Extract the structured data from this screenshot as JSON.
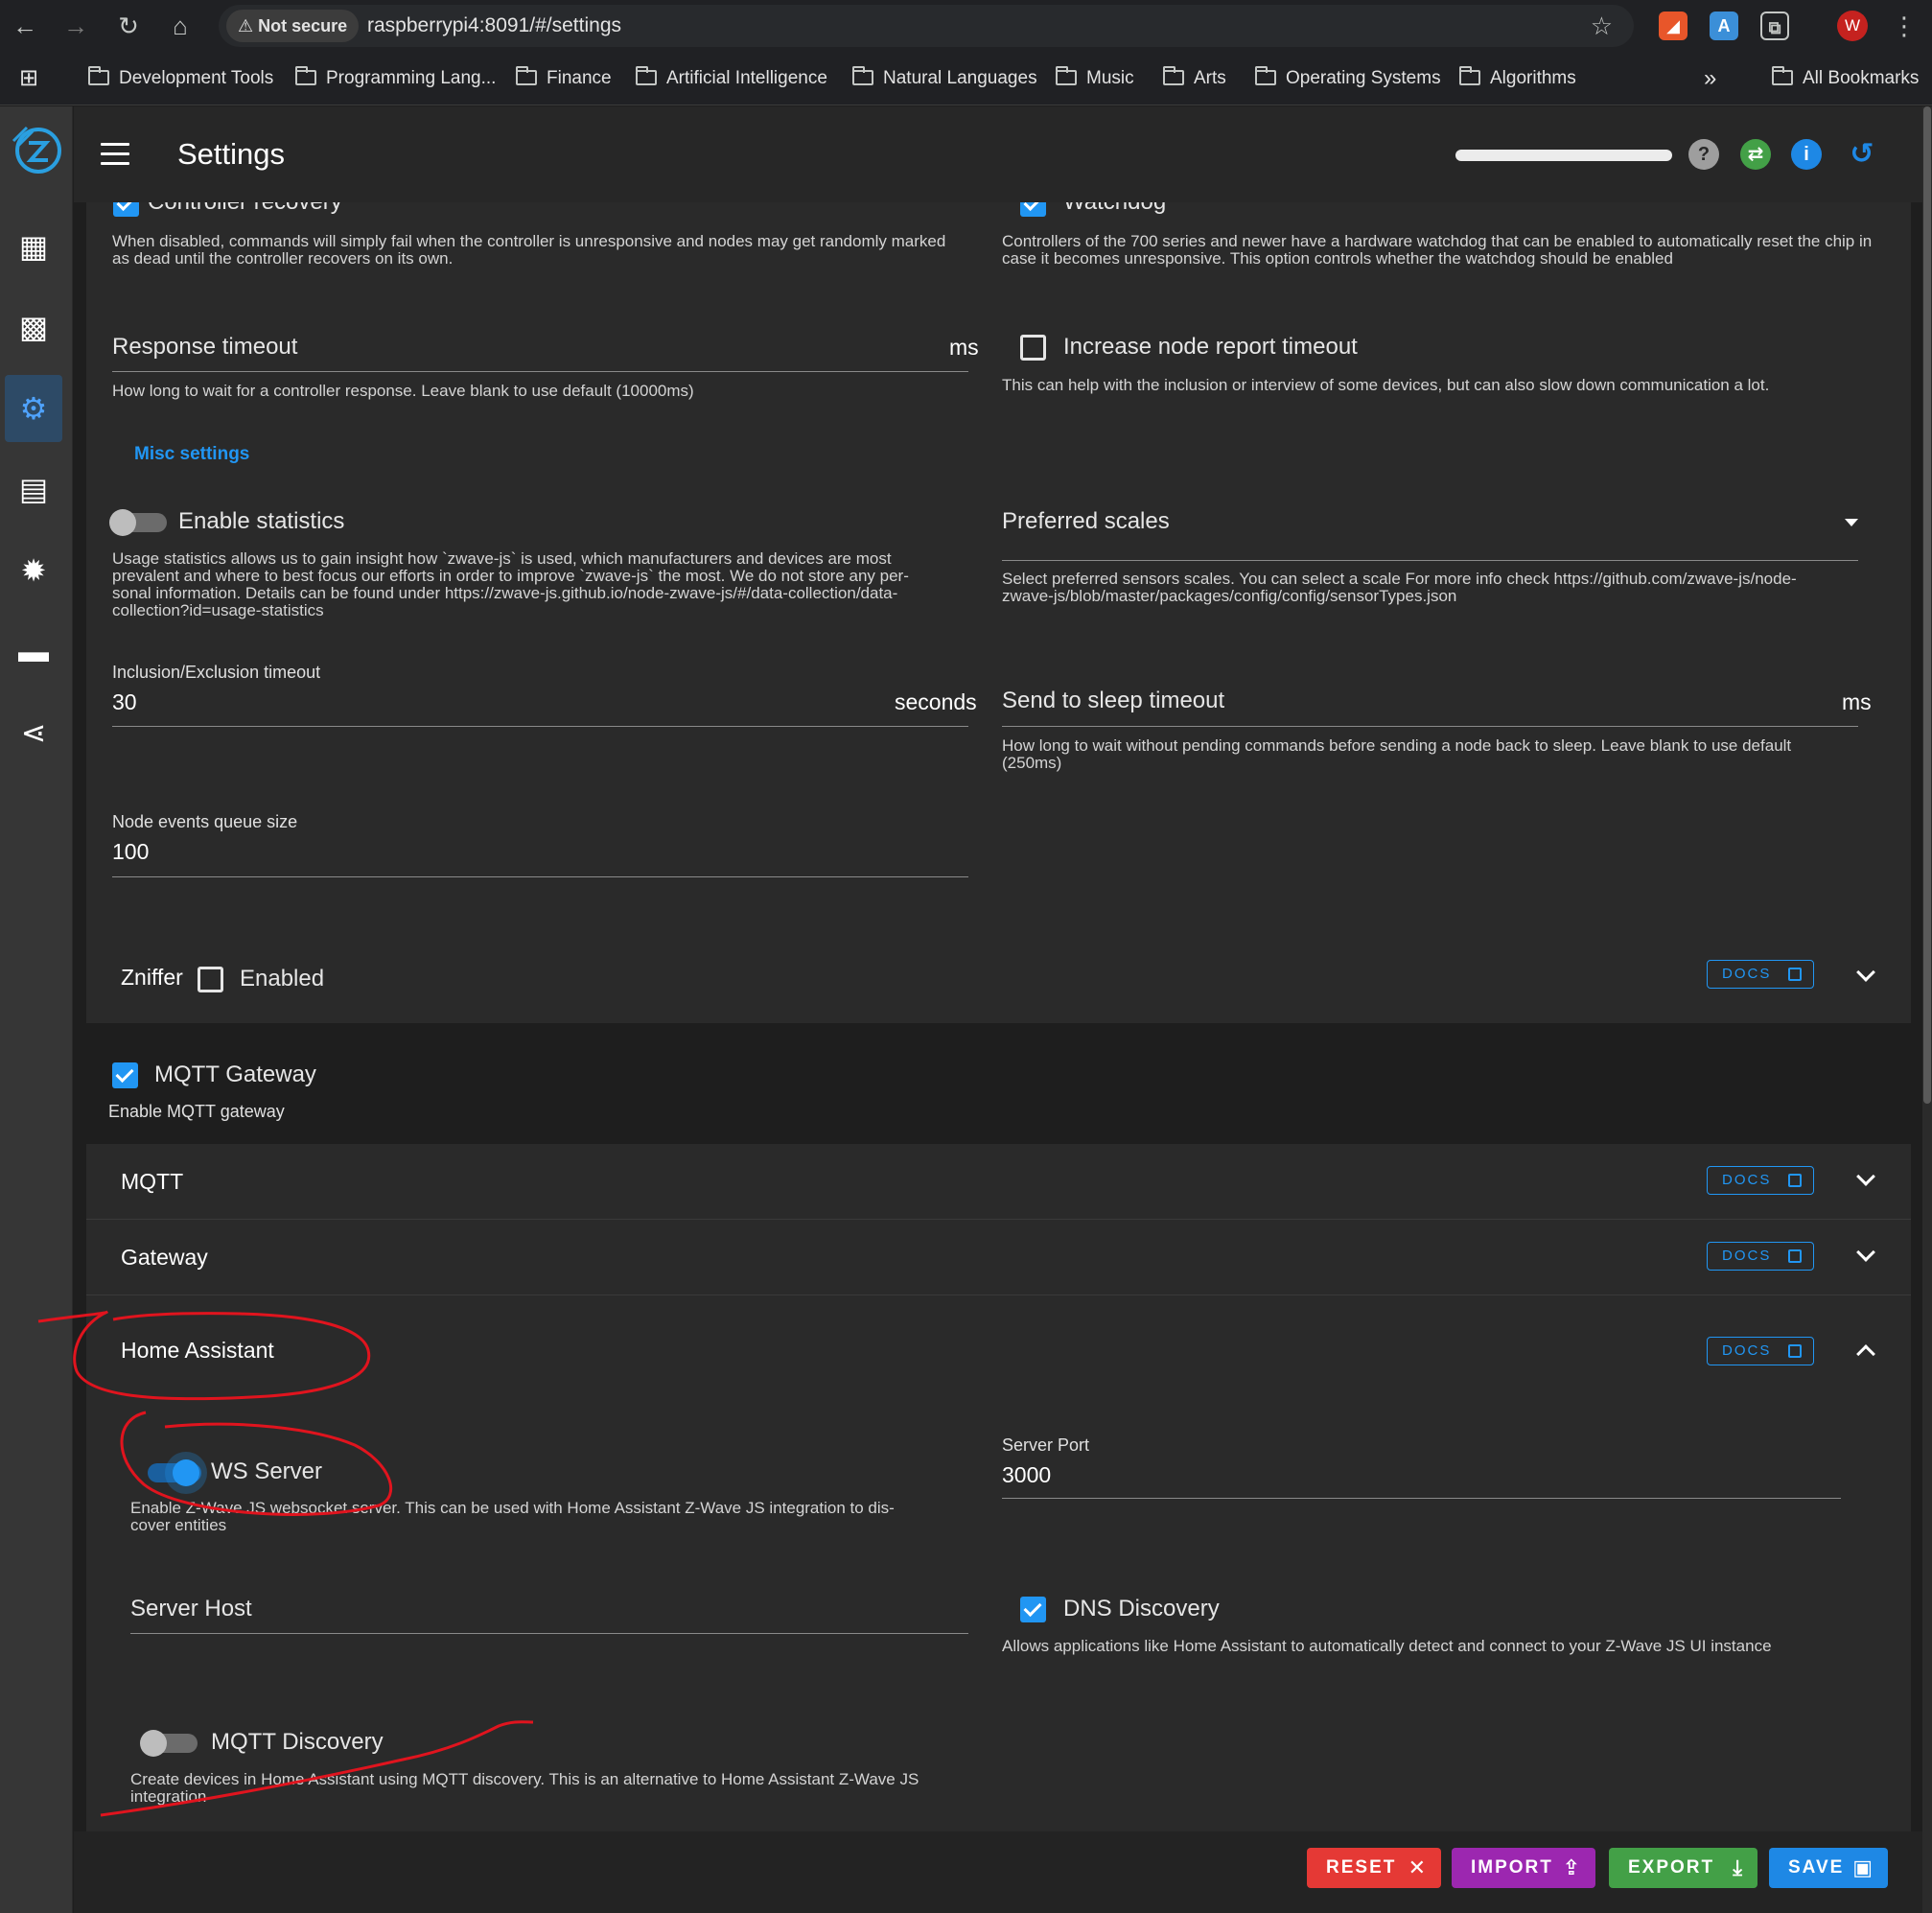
{
  "browser": {
    "not_secure": "Not secure",
    "url": "raspberrypi4:8091/#/settings",
    "avatar_letter": "W",
    "bookmarks": [
      "Development Tools",
      "Programming Lang...",
      "Finance",
      "Artificial Intelligence",
      "Natural Languages",
      "Music",
      "Arts",
      "Operating Systems",
      "Algorithms"
    ],
    "all_bookmarks": "All Bookmarks",
    "overflow": "»"
  },
  "app": {
    "title": "Settings",
    "progress_fraction": 1.0,
    "sidebar_icons": [
      "dashboard-icon",
      "qr-code-icon",
      "settings-icon",
      "scenes-icon",
      "debug-icon",
      "store-icon",
      "network-graph-icon"
    ],
    "active_sidebar": "settings-icon"
  },
  "zwave": {
    "controller_recovery": "Controller recovery",
    "controller_recovery_hint": "When disabled, commands will simply fail when the controller is unresponsive and nodes may get randomly marked as dead until the controller recovers on its own.",
    "watchdog": "Watchdog",
    "watchdog_hint": "Controllers of the 700 series and newer have a hardware watchdog that can be enabled to automatically reset the chip in case it becomes unresponsive. This option controls whether the watchdog should be enabled",
    "response_timeout": "Response timeout",
    "response_timeout_suffix": "ms",
    "response_timeout_hint": "How long to wait for a controller response. Leave blank to use default (10000ms)",
    "increase_report_timeout": "Increase node report timeout",
    "increase_report_timeout_hint": "This can help with the inclusion or interview of some devices, but can also slow down communication a lot.",
    "misc_settings": "Misc settings",
    "enable_statistics": "Enable statistics",
    "enable_statistics_hint_1": "Usage statistics allows us to gain insight how `zwave-js` is used, which manufacturers and devices are most",
    "enable_statistics_hint_2": "prevalent and where to best focus our efforts in order to improve `zwave-js` the most. We do not store any per-",
    "enable_statistics_hint_3": "sonal information. Details can be found under https://zwave-js.github.io/node-zwave-js/#/data-collection/data-",
    "enable_statistics_hint_4": "collection?id=usage-statistics",
    "preferred_scales": "Preferred scales",
    "preferred_scales_hint_1": "Select preferred sensors scales. You can select a scale For more info check https://github.com/zwave-js/node-",
    "preferred_scales_hint_2": "zwave-js/blob/master/packages/config/config/sensorTypes.json",
    "inclusion_timeout_label": "Inclusion/Exclusion timeout",
    "inclusion_timeout_value": "30",
    "inclusion_timeout_suffix": "seconds",
    "send_sleep_timeout": "Send to sleep timeout",
    "send_sleep_suffix": "ms",
    "send_sleep_hint_1": "How long to wait without pending commands before sending a node back to sleep. Leave blank to use default",
    "send_sleep_hint_2": "(250ms)",
    "node_queue_label": "Node events queue size",
    "node_queue_value": "100"
  },
  "zniffer": {
    "title": "Zniffer",
    "enabled": "Enabled",
    "docs": "DOCS"
  },
  "mqtt_gateway": {
    "title": "MQTT Gateway",
    "hint": "Enable MQTT gateway"
  },
  "sections": {
    "mqtt": "MQTT",
    "gateway": "Gateway",
    "home_assistant": "Home Assistant",
    "docs": "DOCS"
  },
  "home_assistant": {
    "ws_server": "WS Server",
    "ws_server_hint_1": "Enable Z-Wave JS websocket server. This can be used with Home Assistant Z-Wave JS integration to dis-",
    "ws_server_hint_2": "cover entities",
    "server_port_label": "Server Port",
    "server_port_value": "3000",
    "server_host": "Server Host",
    "dns_discovery": "DNS Discovery",
    "dns_discovery_hint": "Allows applications like Home Assistant to automatically detect and connect to your Z-Wave JS UI instance",
    "mqtt_discovery": "MQTT Discovery",
    "mqtt_discovery_hint_1": "Create devices in Home Assistant using MQTT discovery. This is an alternative to Home Assistant Z-Wave JS",
    "mqtt_discovery_hint_2": "integration"
  },
  "footer": {
    "reset": "RESET",
    "import": "IMPORT",
    "export": "EXPORT",
    "save": "SAVE"
  },
  "colors": {
    "accent": "#2196f3",
    "reset": "#e53935",
    "import": "#9c27b0",
    "export": "#43a047",
    "save": "#1e88e5",
    "annotation": "#e0141e"
  }
}
